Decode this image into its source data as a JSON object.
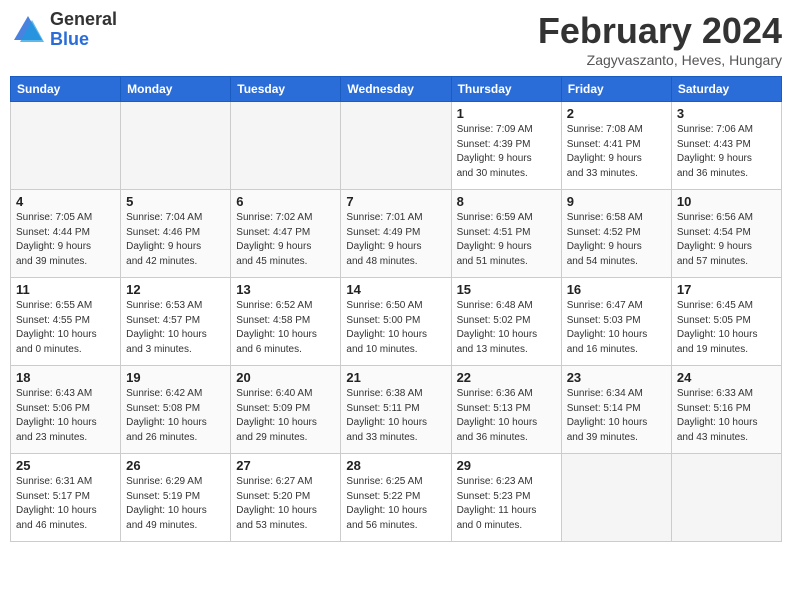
{
  "header": {
    "logo_general": "General",
    "logo_blue": "Blue",
    "title": "February 2024",
    "subtitle": "Zagyvaszanto, Heves, Hungary"
  },
  "days_of_week": [
    "Sunday",
    "Monday",
    "Tuesday",
    "Wednesday",
    "Thursday",
    "Friday",
    "Saturday"
  ],
  "weeks": [
    [
      {
        "day": "",
        "info": ""
      },
      {
        "day": "",
        "info": ""
      },
      {
        "day": "",
        "info": ""
      },
      {
        "day": "",
        "info": ""
      },
      {
        "day": "1",
        "info": "Sunrise: 7:09 AM\nSunset: 4:39 PM\nDaylight: 9 hours\nand 30 minutes."
      },
      {
        "day": "2",
        "info": "Sunrise: 7:08 AM\nSunset: 4:41 PM\nDaylight: 9 hours\nand 33 minutes."
      },
      {
        "day": "3",
        "info": "Sunrise: 7:06 AM\nSunset: 4:43 PM\nDaylight: 9 hours\nand 36 minutes."
      }
    ],
    [
      {
        "day": "4",
        "info": "Sunrise: 7:05 AM\nSunset: 4:44 PM\nDaylight: 9 hours\nand 39 minutes."
      },
      {
        "day": "5",
        "info": "Sunrise: 7:04 AM\nSunset: 4:46 PM\nDaylight: 9 hours\nand 42 minutes."
      },
      {
        "day": "6",
        "info": "Sunrise: 7:02 AM\nSunset: 4:47 PM\nDaylight: 9 hours\nand 45 minutes."
      },
      {
        "day": "7",
        "info": "Sunrise: 7:01 AM\nSunset: 4:49 PM\nDaylight: 9 hours\nand 48 minutes."
      },
      {
        "day": "8",
        "info": "Sunrise: 6:59 AM\nSunset: 4:51 PM\nDaylight: 9 hours\nand 51 minutes."
      },
      {
        "day": "9",
        "info": "Sunrise: 6:58 AM\nSunset: 4:52 PM\nDaylight: 9 hours\nand 54 minutes."
      },
      {
        "day": "10",
        "info": "Sunrise: 6:56 AM\nSunset: 4:54 PM\nDaylight: 9 hours\nand 57 minutes."
      }
    ],
    [
      {
        "day": "11",
        "info": "Sunrise: 6:55 AM\nSunset: 4:55 PM\nDaylight: 10 hours\nand 0 minutes."
      },
      {
        "day": "12",
        "info": "Sunrise: 6:53 AM\nSunset: 4:57 PM\nDaylight: 10 hours\nand 3 minutes."
      },
      {
        "day": "13",
        "info": "Sunrise: 6:52 AM\nSunset: 4:58 PM\nDaylight: 10 hours\nand 6 minutes."
      },
      {
        "day": "14",
        "info": "Sunrise: 6:50 AM\nSunset: 5:00 PM\nDaylight: 10 hours\nand 10 minutes."
      },
      {
        "day": "15",
        "info": "Sunrise: 6:48 AM\nSunset: 5:02 PM\nDaylight: 10 hours\nand 13 minutes."
      },
      {
        "day": "16",
        "info": "Sunrise: 6:47 AM\nSunset: 5:03 PM\nDaylight: 10 hours\nand 16 minutes."
      },
      {
        "day": "17",
        "info": "Sunrise: 6:45 AM\nSunset: 5:05 PM\nDaylight: 10 hours\nand 19 minutes."
      }
    ],
    [
      {
        "day": "18",
        "info": "Sunrise: 6:43 AM\nSunset: 5:06 PM\nDaylight: 10 hours\nand 23 minutes."
      },
      {
        "day": "19",
        "info": "Sunrise: 6:42 AM\nSunset: 5:08 PM\nDaylight: 10 hours\nand 26 minutes."
      },
      {
        "day": "20",
        "info": "Sunrise: 6:40 AM\nSunset: 5:09 PM\nDaylight: 10 hours\nand 29 minutes."
      },
      {
        "day": "21",
        "info": "Sunrise: 6:38 AM\nSunset: 5:11 PM\nDaylight: 10 hours\nand 33 minutes."
      },
      {
        "day": "22",
        "info": "Sunrise: 6:36 AM\nSunset: 5:13 PM\nDaylight: 10 hours\nand 36 minutes."
      },
      {
        "day": "23",
        "info": "Sunrise: 6:34 AM\nSunset: 5:14 PM\nDaylight: 10 hours\nand 39 minutes."
      },
      {
        "day": "24",
        "info": "Sunrise: 6:33 AM\nSunset: 5:16 PM\nDaylight: 10 hours\nand 43 minutes."
      }
    ],
    [
      {
        "day": "25",
        "info": "Sunrise: 6:31 AM\nSunset: 5:17 PM\nDaylight: 10 hours\nand 46 minutes."
      },
      {
        "day": "26",
        "info": "Sunrise: 6:29 AM\nSunset: 5:19 PM\nDaylight: 10 hours\nand 49 minutes."
      },
      {
        "day": "27",
        "info": "Sunrise: 6:27 AM\nSunset: 5:20 PM\nDaylight: 10 hours\nand 53 minutes."
      },
      {
        "day": "28",
        "info": "Sunrise: 6:25 AM\nSunset: 5:22 PM\nDaylight: 10 hours\nand 56 minutes."
      },
      {
        "day": "29",
        "info": "Sunrise: 6:23 AM\nSunset: 5:23 PM\nDaylight: 11 hours\nand 0 minutes."
      },
      {
        "day": "",
        "info": ""
      },
      {
        "day": "",
        "info": ""
      }
    ]
  ]
}
